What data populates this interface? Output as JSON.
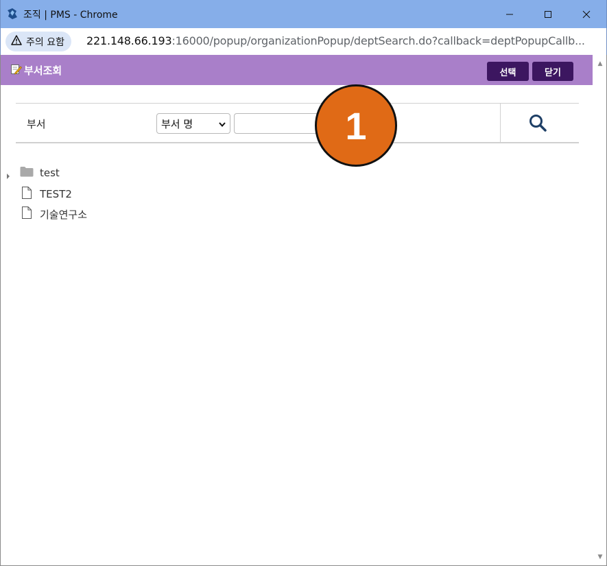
{
  "window": {
    "title": "조직 | PMS - Chrome"
  },
  "address_bar": {
    "security_label": "주의 요함",
    "url_host": "221.148.66.193",
    "url_rest": ":16000/popup/organizationPopup/deptSearch.do?callback=deptPopupCallb..."
  },
  "popup": {
    "title": "부서조회",
    "select_button": "선택",
    "close_button": "닫기"
  },
  "search": {
    "label": "부서",
    "field_selected": "부서 명",
    "input_value": ""
  },
  "step_marker": "1",
  "tree": {
    "items": [
      {
        "label": "test",
        "type": "folder"
      },
      {
        "label": "TEST2",
        "type": "document"
      },
      {
        "label": "기술연구소",
        "type": "document"
      }
    ]
  }
}
